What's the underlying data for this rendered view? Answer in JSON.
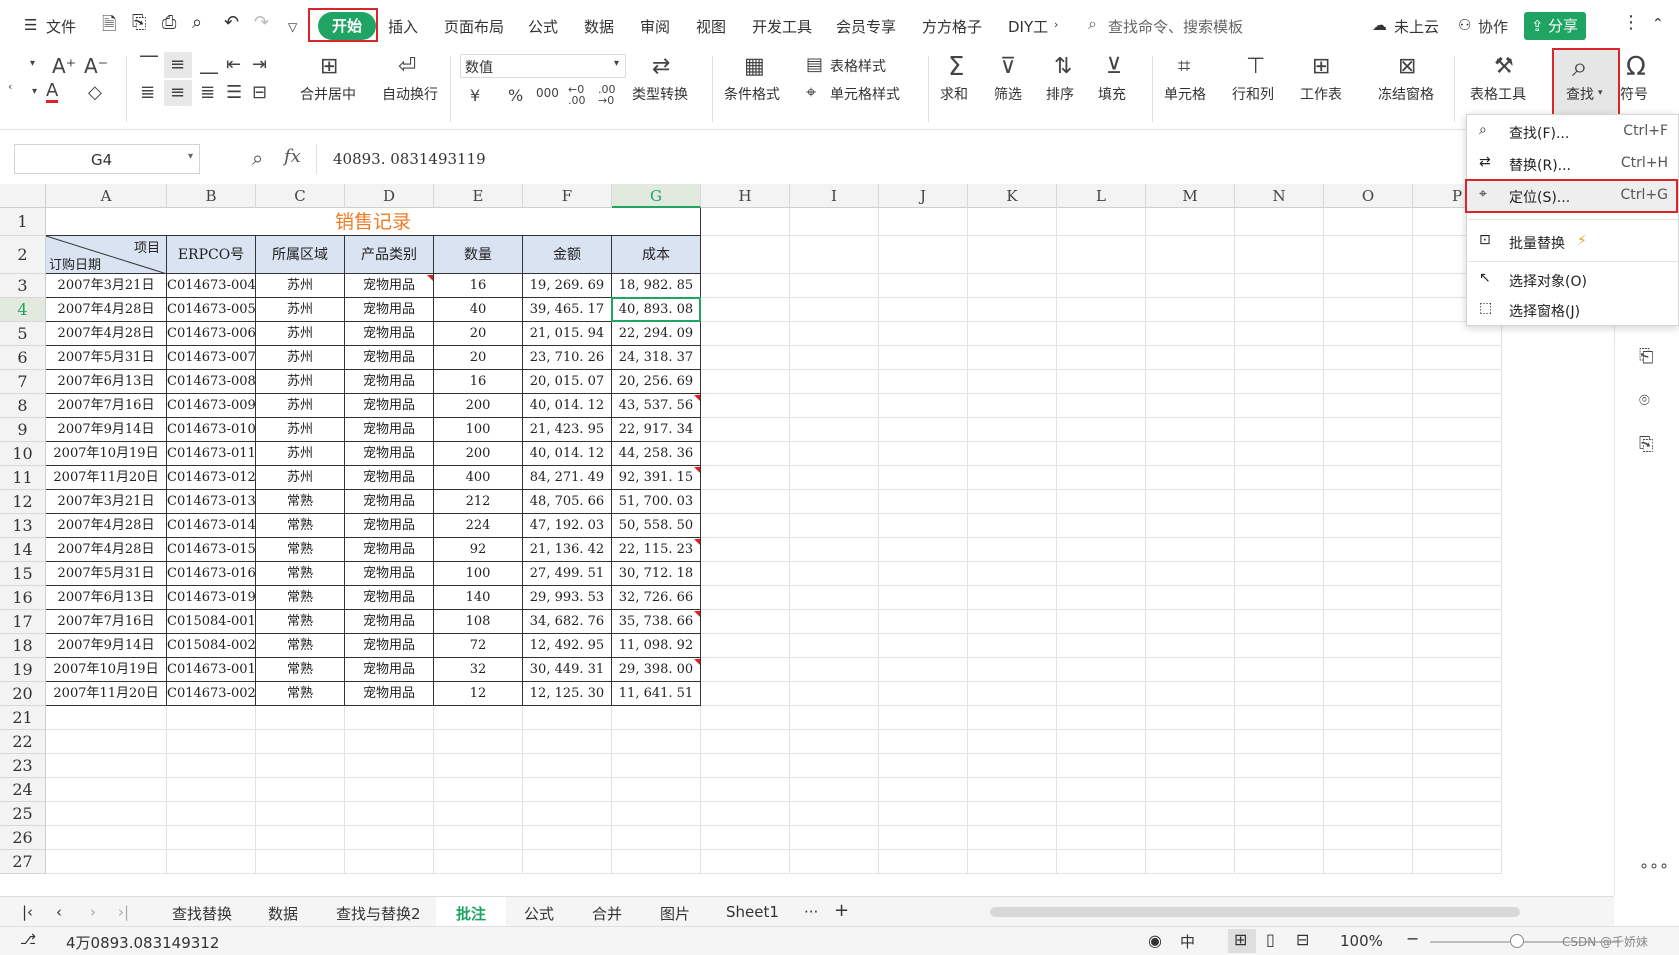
{
  "menubar": {
    "file": "文件",
    "tabs": [
      "开始",
      "插入",
      "页面布局",
      "公式",
      "数据",
      "审阅",
      "视图",
      "开发工具",
      "会员专享",
      "方方格子",
      "DIY工"
    ],
    "search_placeholder": "查找命令、搜索模板",
    "cloud": "未上云",
    "collab": "协作",
    "share": "分享"
  },
  "ribbon": {
    "merge": "合并居中",
    "wrap": "自动换行",
    "number_format": "数值",
    "type_convert": "类型转换",
    "cond_format": "条件格式",
    "table_style": "表格样式",
    "cell_style": "单元格样式",
    "sum": "求和",
    "filter": "筛选",
    "sort": "排序",
    "fill": "填充",
    "cell": "单元格",
    "rowcol": "行和列",
    "sheet": "工作表",
    "freeze": "冻结窗格",
    "tools": "表格工具",
    "find": "查找",
    "symbol": "符号",
    "currency": "¥",
    "percent": "%",
    "thousands": "000"
  },
  "formula_bar": {
    "name_box": "G4",
    "fx": "fx",
    "value": "40893. 0831493119"
  },
  "sheet": {
    "columns": [
      "A",
      "B",
      "C",
      "D",
      "E",
      "F",
      "G",
      "H",
      "I",
      "J",
      "K",
      "L",
      "M",
      "N",
      "O",
      "P"
    ],
    "rows": [
      "1",
      "2",
      "3",
      "4",
      "5",
      "6",
      "7",
      "8",
      "9",
      "10",
      "11",
      "12",
      "13",
      "14",
      "15",
      "16",
      "17",
      "18",
      "19",
      "20",
      "21",
      "22",
      "23",
      "24",
      "25",
      "26",
      "27"
    ],
    "title": "销售记录",
    "diag_top": "项目",
    "diag_bottom": "订购日期",
    "headers": [
      "ERPCO号",
      "所属区域",
      "产品类别",
      "数量",
      "金额",
      "成本"
    ],
    "data": [
      [
        "2007年3月21日",
        "C014673-004",
        "苏州",
        "宠物用品",
        "16",
        "19, 269. 69",
        "18, 982. 85"
      ],
      [
        "2007年4月28日",
        "C014673-005",
        "苏州",
        "宠物用品",
        "40",
        "39, 465. 17",
        "40, 893. 08"
      ],
      [
        "2007年4月28日",
        "C014673-006",
        "苏州",
        "宠物用品",
        "20",
        "21, 015. 94",
        "22, 294. 09"
      ],
      [
        "2007年5月31日",
        "C014673-007",
        "苏州",
        "宠物用品",
        "20",
        "23, 710. 26",
        "24, 318. 37"
      ],
      [
        "2007年6月13日",
        "C014673-008",
        "苏州",
        "宠物用品",
        "16",
        "20, 015. 07",
        "20, 256. 69"
      ],
      [
        "2007年7月16日",
        "C014673-009",
        "苏州",
        "宠物用品",
        "200",
        "40, 014. 12",
        "43, 537. 56"
      ],
      [
        "2007年9月14日",
        "C014673-010",
        "苏州",
        "宠物用品",
        "100",
        "21, 423. 95",
        "22, 917. 34"
      ],
      [
        "2007年10月19日",
        "C014673-011",
        "苏州",
        "宠物用品",
        "200",
        "40, 014. 12",
        "44, 258. 36"
      ],
      [
        "2007年11月20日",
        "C014673-012",
        "苏州",
        "宠物用品",
        "400",
        "84, 271. 49",
        "92, 391. 15"
      ],
      [
        "2007年3月21日",
        "C014673-013",
        "常熟",
        "宠物用品",
        "212",
        "48, 705. 66",
        "51, 700. 03"
      ],
      [
        "2007年4月28日",
        "C014673-014",
        "常熟",
        "宠物用品",
        "224",
        "47, 192. 03",
        "50, 558. 50"
      ],
      [
        "2007年4月28日",
        "C014673-015",
        "常熟",
        "宠物用品",
        "92",
        "21, 136. 42",
        "22, 115. 23"
      ],
      [
        "2007年5月31日",
        "C014673-016",
        "常熟",
        "宠物用品",
        "100",
        "27, 499. 51",
        "30, 712. 18"
      ],
      [
        "2007年6月13日",
        "C014673-019",
        "常熟",
        "宠物用品",
        "140",
        "29, 993. 53",
        "32, 726. 66"
      ],
      [
        "2007年7月16日",
        "C015084-001",
        "常熟",
        "宠物用品",
        "108",
        "34, 682. 76",
        "35, 738. 66"
      ],
      [
        "2007年9月14日",
        "C015084-002",
        "常熟",
        "宠物用品",
        "72",
        "12, 492. 95",
        "11, 098. 92"
      ],
      [
        "2007年10月19日",
        "C014673-001",
        "常熟",
        "宠物用品",
        "32",
        "30, 449. 31",
        "29, 398. 00"
      ],
      [
        "2007年11月20日",
        "C014673-002",
        "常熟",
        "宠物用品",
        "12",
        "12, 125. 30",
        "11, 641. 51"
      ]
    ]
  },
  "sheet_tabs": [
    "查找替换",
    "数据",
    "查找与替换2",
    "批注",
    "公式",
    "合并",
    "图片",
    "Sheet1"
  ],
  "active_tab": "批注",
  "statusbar": {
    "value": "4万0893.083149312",
    "zoom": "100%",
    "watermark": "CSDN @千娇妹"
  },
  "dropdown": {
    "items": [
      {
        "label": "查找(F)...",
        "shortcut": "Ctrl+F"
      },
      {
        "label": "替换(R)...",
        "shortcut": "Ctrl+H"
      },
      {
        "label": "定位(S)...",
        "shortcut": "Ctrl+G"
      },
      {
        "label": "批量替换",
        "shortcut": ""
      },
      {
        "label": "选择对象(O)",
        "shortcut": ""
      },
      {
        "label": "选择窗格(J)",
        "shortcut": ""
      }
    ]
  },
  "colors": {
    "accent": "#1fa463",
    "highlight": "#d9262b",
    "title": "#f07c24",
    "header_fill": "#d9e3f1"
  }
}
